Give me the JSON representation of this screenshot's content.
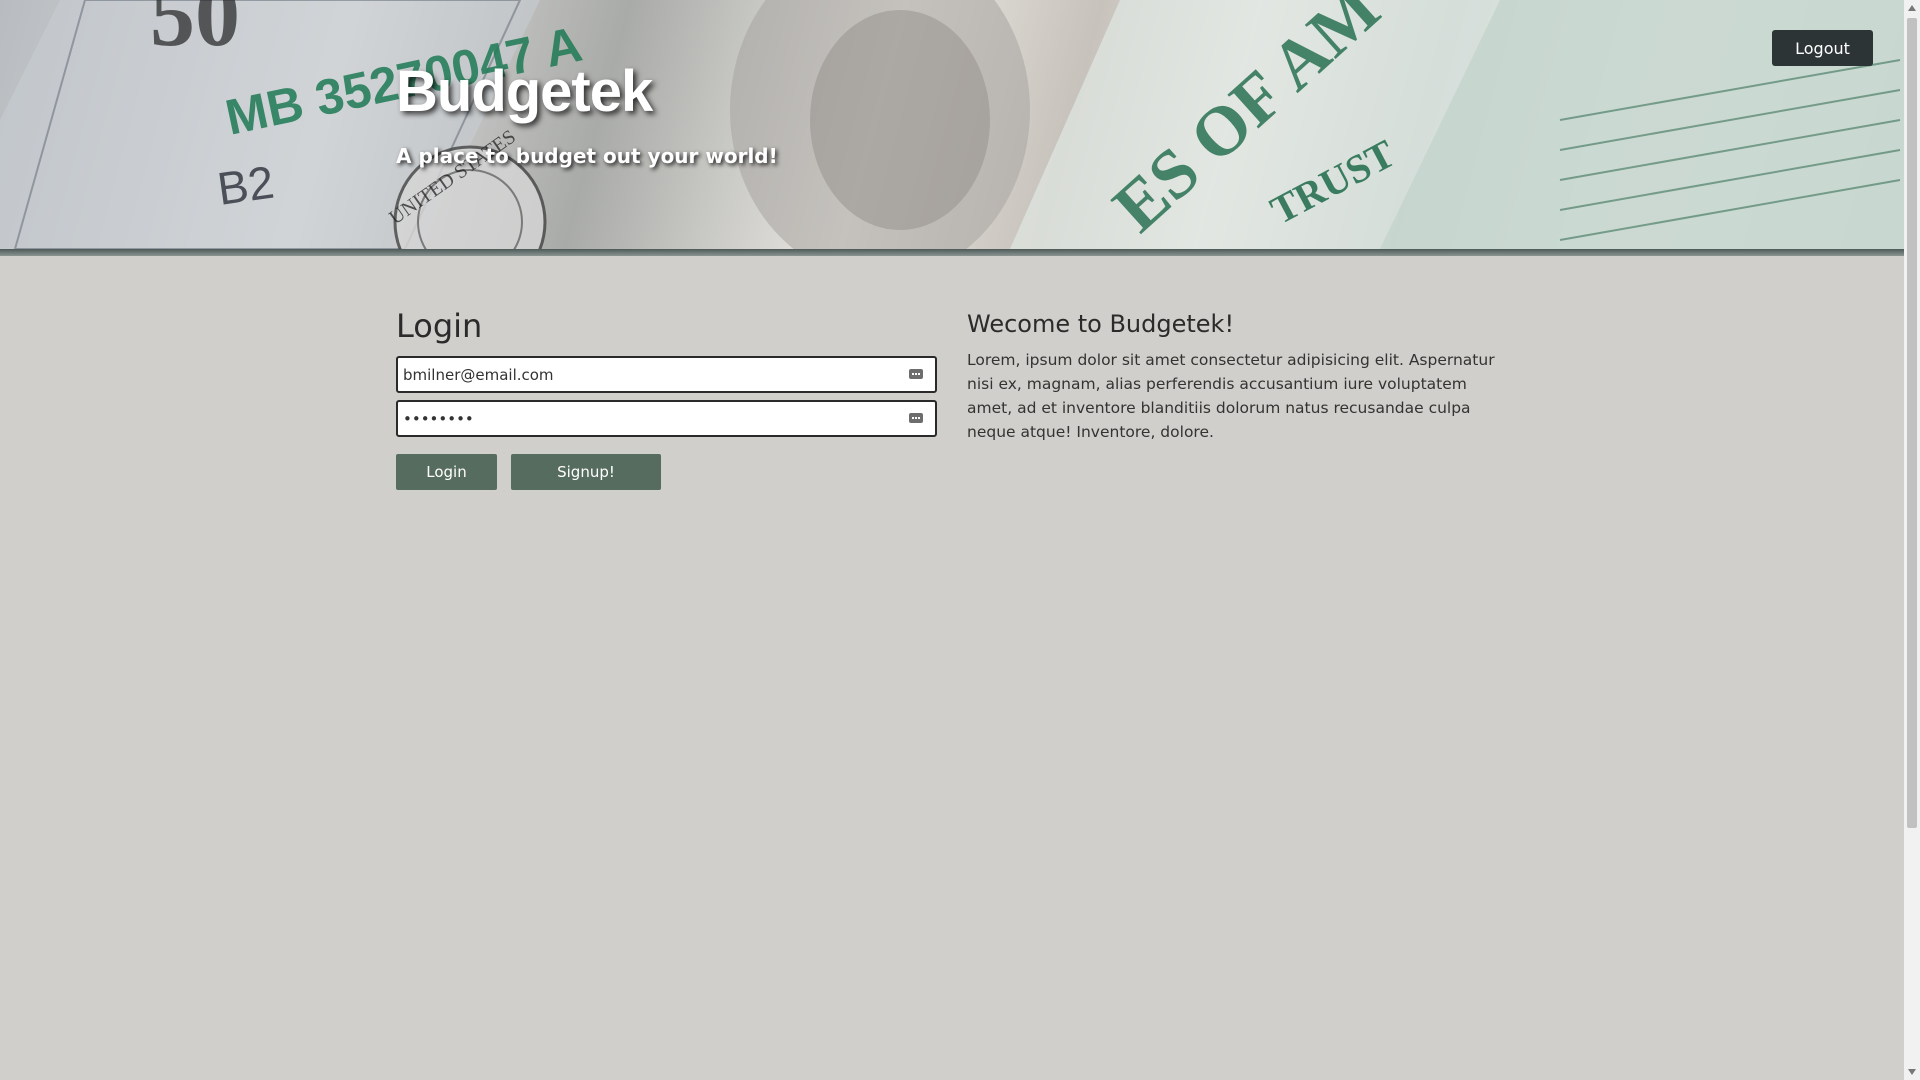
{
  "header": {
    "brand": "Budgetek",
    "tagline": "A place to budget out your world!",
    "logout_label": "Logout",
    "banner_text": {
      "serial": "MB 35270047 A",
      "bill_code": "B2",
      "denomination": "50",
      "seal_text": "UNITED STATES",
      "trust_text": "TRUST",
      "motto_fragment": "ES OF AM"
    }
  },
  "login": {
    "title": "Login",
    "email_value": "bmilner@email.com",
    "password_value": "••••••••",
    "login_label": "Login",
    "signup_label": "Signup!"
  },
  "welcome": {
    "title": "Wecome to Budgetek!",
    "text": "Lorem, ipsum dolor sit amet consectetur adipisicing elit. Aspernatur nisi ex, magnam, alias perferendis accusantium iure voluptatem amet, ad et inventore blanditiis dolorum natus recusandae culpa neque atque! Inventore, dolore."
  },
  "colors": {
    "page_bg": "#d0cfcb",
    "button_green": "#566c5e",
    "logout_dark": "#2d3436",
    "header_border": "#4d5a58"
  },
  "icons": {
    "field_key": "key-icon",
    "scroll_up": "chevron-up-icon",
    "scroll_down": "chevron-down-icon"
  }
}
